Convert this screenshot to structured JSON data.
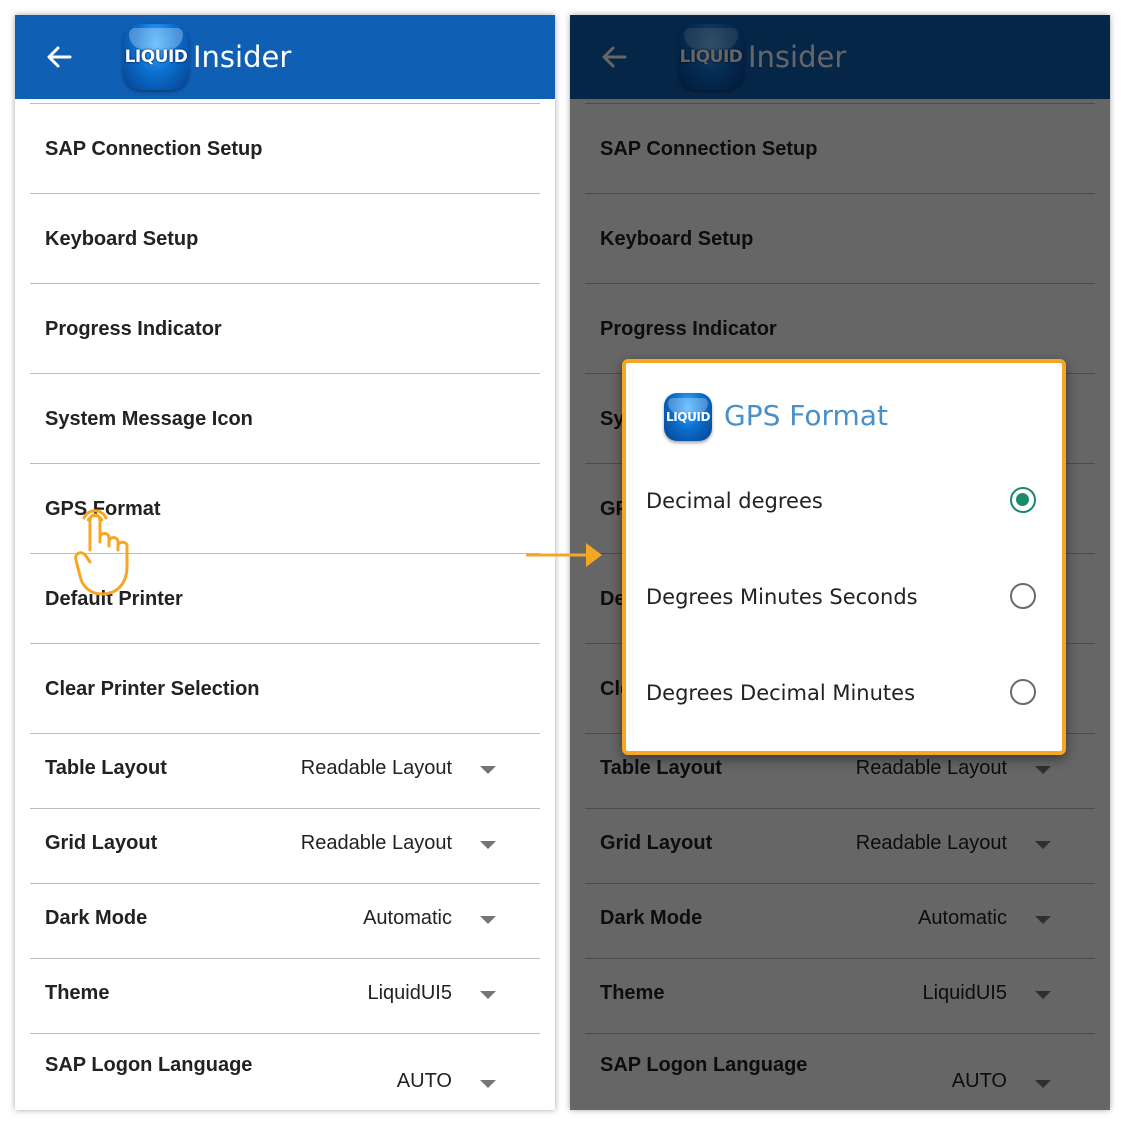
{
  "app": {
    "logo_prefix": "LIQ",
    "logo_suffix": "UID",
    "name": "Insider"
  },
  "settings": [
    {
      "label": "SAP Connection Setup"
    },
    {
      "label": "Keyboard Setup"
    },
    {
      "label": "Progress Indicator"
    },
    {
      "label": "System Message Icon"
    },
    {
      "label": "GPS Format"
    },
    {
      "label": "Default Printer"
    },
    {
      "label": "Clear Printer Selection"
    },
    {
      "label": "Table Layout",
      "value": "Readable Layout"
    },
    {
      "label": "Grid Layout",
      "value": "Readable Layout"
    },
    {
      "label": "Dark Mode",
      "value": "Automatic"
    },
    {
      "label": "Theme",
      "value": "LiquidUI5"
    },
    {
      "label": "SAP Logon Language",
      "value": "AUTO"
    }
  ],
  "dialog": {
    "logo_text": "LIQUID",
    "title": "GPS Format",
    "options": [
      {
        "label": "Decimal degrees",
        "selected": true
      },
      {
        "label": "Degrees Minutes Seconds",
        "selected": false
      },
      {
        "label": "Degrees Decimal Minutes",
        "selected": false
      }
    ]
  },
  "colors": {
    "appbar": "#0F5FB5",
    "dialog_border": "#F5A623",
    "dialog_title": "#4A90C8",
    "radio_selected": "#1B8A6B"
  },
  "icons": {
    "back": "arrow-left-icon",
    "tap_hint": "hand-pointer-icon",
    "flow": "arrow-right-icon"
  }
}
